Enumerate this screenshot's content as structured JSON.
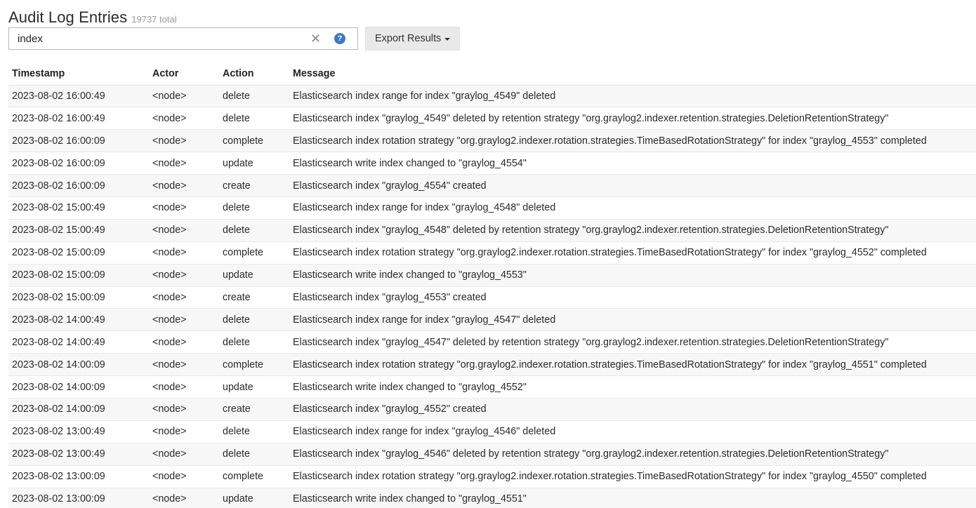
{
  "header": {
    "title": "Audit Log Entries",
    "total": "19737 total"
  },
  "search": {
    "value": "index",
    "clear_symbol": "✕",
    "help_symbol": "?"
  },
  "toolbar": {
    "export_label": "Export Results"
  },
  "table": {
    "columns": [
      "Timestamp",
      "Actor",
      "Action",
      "Message"
    ],
    "rows": [
      [
        "2023-08-02 16:00:49",
        "<node>",
        "delete",
        "Elasticsearch index range for index \"graylog_4549\" deleted"
      ],
      [
        "2023-08-02 16:00:49",
        "<node>",
        "delete",
        "Elasticsearch index \"graylog_4549\" deleted by retention strategy \"org.graylog2.indexer.retention.strategies.DeletionRetentionStrategy\""
      ],
      [
        "2023-08-02 16:00:09",
        "<node>",
        "complete",
        "Elasticsearch index rotation strategy \"org.graylog2.indexer.rotation.strategies.TimeBasedRotationStrategy\" for index \"graylog_4553\" completed"
      ],
      [
        "2023-08-02 16:00:09",
        "<node>",
        "update",
        "Elasticsearch write index changed to \"graylog_4554\""
      ],
      [
        "2023-08-02 16:00:09",
        "<node>",
        "create",
        "Elasticsearch index \"graylog_4554\" created"
      ],
      [
        "2023-08-02 15:00:49",
        "<node>",
        "delete",
        "Elasticsearch index range for index \"graylog_4548\" deleted"
      ],
      [
        "2023-08-02 15:00:49",
        "<node>",
        "delete",
        "Elasticsearch index \"graylog_4548\" deleted by retention strategy \"org.graylog2.indexer.retention.strategies.DeletionRetentionStrategy\""
      ],
      [
        "2023-08-02 15:00:09",
        "<node>",
        "complete",
        "Elasticsearch index rotation strategy \"org.graylog2.indexer.rotation.strategies.TimeBasedRotationStrategy\" for index \"graylog_4552\" completed"
      ],
      [
        "2023-08-02 15:00:09",
        "<node>",
        "update",
        "Elasticsearch write index changed to \"graylog_4553\""
      ],
      [
        "2023-08-02 15:00:09",
        "<node>",
        "create",
        "Elasticsearch index \"graylog_4553\" created"
      ],
      [
        "2023-08-02 14:00:49",
        "<node>",
        "delete",
        "Elasticsearch index range for index \"graylog_4547\" deleted"
      ],
      [
        "2023-08-02 14:00:49",
        "<node>",
        "delete",
        "Elasticsearch index \"graylog_4547\" deleted by retention strategy \"org.graylog2.indexer.retention.strategies.DeletionRetentionStrategy\""
      ],
      [
        "2023-08-02 14:00:09",
        "<node>",
        "complete",
        "Elasticsearch index rotation strategy \"org.graylog2.indexer.rotation.strategies.TimeBasedRotationStrategy\" for index \"graylog_4551\" completed"
      ],
      [
        "2023-08-02 14:00:09",
        "<node>",
        "update",
        "Elasticsearch write index changed to \"graylog_4552\""
      ],
      [
        "2023-08-02 14:00:09",
        "<node>",
        "create",
        "Elasticsearch index \"graylog_4552\" created"
      ],
      [
        "2023-08-02 13:00:49",
        "<node>",
        "delete",
        "Elasticsearch index range for index \"graylog_4546\" deleted"
      ],
      [
        "2023-08-02 13:00:49",
        "<node>",
        "delete",
        "Elasticsearch index \"graylog_4546\" deleted by retention strategy \"org.graylog2.indexer.retention.strategies.DeletionRetentionStrategy\""
      ],
      [
        "2023-08-02 13:00:09",
        "<node>",
        "complete",
        "Elasticsearch index rotation strategy \"org.graylog2.indexer.rotation.strategies.TimeBasedRotationStrategy\" for index \"graylog_4550\" completed"
      ],
      [
        "2023-08-02 13:00:09",
        "<node>",
        "update",
        "Elasticsearch write index changed to \"graylog_4551\""
      ]
    ]
  },
  "colors": {
    "help_icon": "#3d78c8",
    "row_stripe": "#f7f7f7",
    "button_bg": "#e9e9e9"
  }
}
